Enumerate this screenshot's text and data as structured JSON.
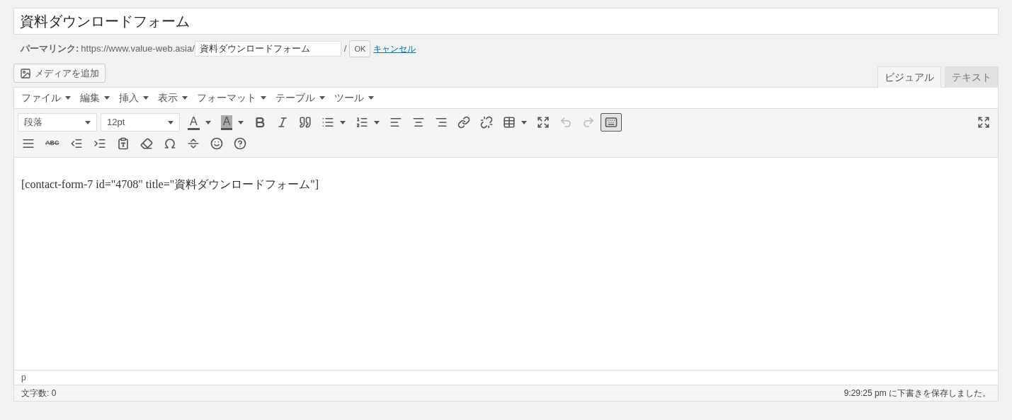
{
  "title_field": {
    "value": "資料ダウンロードフォーム"
  },
  "permalink": {
    "label": "パーマリンク:",
    "base_url": "https://www.value-web.asia/",
    "slug": "資料ダウンロードフォーム",
    "trailing": "/",
    "ok_button": "OK",
    "cancel_link": "キャンセル"
  },
  "add_media_button": "メディアを追加",
  "editor_tabs": [
    {
      "label": "ビジュアル",
      "selected": true
    },
    {
      "label": "テキスト",
      "selected": false
    }
  ],
  "menu": [
    "ファイル",
    "編集",
    "挿入",
    "表示",
    "フォーマット",
    "テーブル",
    "ツール"
  ],
  "selects": [
    {
      "value": "段落"
    },
    {
      "value": "12pt"
    }
  ],
  "toolbar_row_1": [
    {
      "kind": "text-color",
      "label": "A",
      "dropdown": true,
      "disabled": false,
      "pressed": false
    },
    {
      "kind": "background-color",
      "label": "A",
      "dropdown": true,
      "disabled": false,
      "pressed": false
    },
    {
      "kind": "bold",
      "dropdown": false,
      "disabled": false,
      "pressed": false
    },
    {
      "kind": "italic",
      "dropdown": false,
      "disabled": false,
      "pressed": false
    },
    {
      "kind": "blockquote",
      "dropdown": false,
      "disabled": false,
      "pressed": false
    },
    {
      "kind": "bullet-list",
      "dropdown": true,
      "disabled": false,
      "pressed": false
    },
    {
      "kind": "numbered-list",
      "dropdown": true,
      "disabled": false,
      "pressed": false
    },
    {
      "kind": "align-left",
      "dropdown": false,
      "disabled": false,
      "pressed": false
    },
    {
      "kind": "align-center",
      "dropdown": false,
      "disabled": false,
      "pressed": false
    },
    {
      "kind": "align-right",
      "dropdown": false,
      "disabled": false,
      "pressed": false
    },
    {
      "kind": "link",
      "dropdown": false,
      "disabled": false,
      "pressed": false
    },
    {
      "kind": "unlink",
      "dropdown": false,
      "disabled": false,
      "pressed": false
    },
    {
      "kind": "table",
      "dropdown": true,
      "disabled": false,
      "pressed": false
    },
    {
      "kind": "fullscreen",
      "dropdown": false,
      "disabled": false,
      "pressed": false
    },
    {
      "kind": "undo",
      "dropdown": false,
      "disabled": true,
      "pressed": false
    },
    {
      "kind": "redo",
      "dropdown": false,
      "disabled": true,
      "pressed": false
    },
    {
      "kind": "toolbar-toggle",
      "dropdown": false,
      "disabled": false,
      "pressed": true
    }
  ],
  "toolbar_row_1_right": [
    {
      "kind": "fullscreen",
      "dropdown": false,
      "disabled": false,
      "pressed": false
    }
  ],
  "toolbar_row_2": [
    {
      "kind": "justify",
      "dropdown": false,
      "disabled": false,
      "pressed": false
    },
    {
      "kind": "strikethrough",
      "label": "ABC",
      "dropdown": false,
      "disabled": false,
      "pressed": false
    },
    {
      "kind": "outdent",
      "dropdown": false,
      "disabled": false,
      "pressed": false
    },
    {
      "kind": "indent",
      "dropdown": false,
      "disabled": false,
      "pressed": false
    },
    {
      "kind": "paste-text",
      "dropdown": false,
      "disabled": false,
      "pressed": false
    },
    {
      "kind": "eraser",
      "dropdown": false,
      "disabled": false,
      "pressed": false
    },
    {
      "kind": "omega",
      "dropdown": false,
      "disabled": false,
      "pressed": false
    },
    {
      "kind": "more",
      "dropdown": false,
      "disabled": false,
      "pressed": false
    },
    {
      "kind": "emoji",
      "dropdown": false,
      "disabled": false,
      "pressed": false
    },
    {
      "kind": "help",
      "dropdown": false,
      "disabled": false,
      "pressed": false
    }
  ],
  "content": "[contact-form-7 id=\"4708\" title=\"資料ダウンロードフォーム\"]",
  "path": "p",
  "status_bar": {
    "word_count": "文字数: 0",
    "saved": "9:29:25 pm に下書きを保存しました。"
  }
}
